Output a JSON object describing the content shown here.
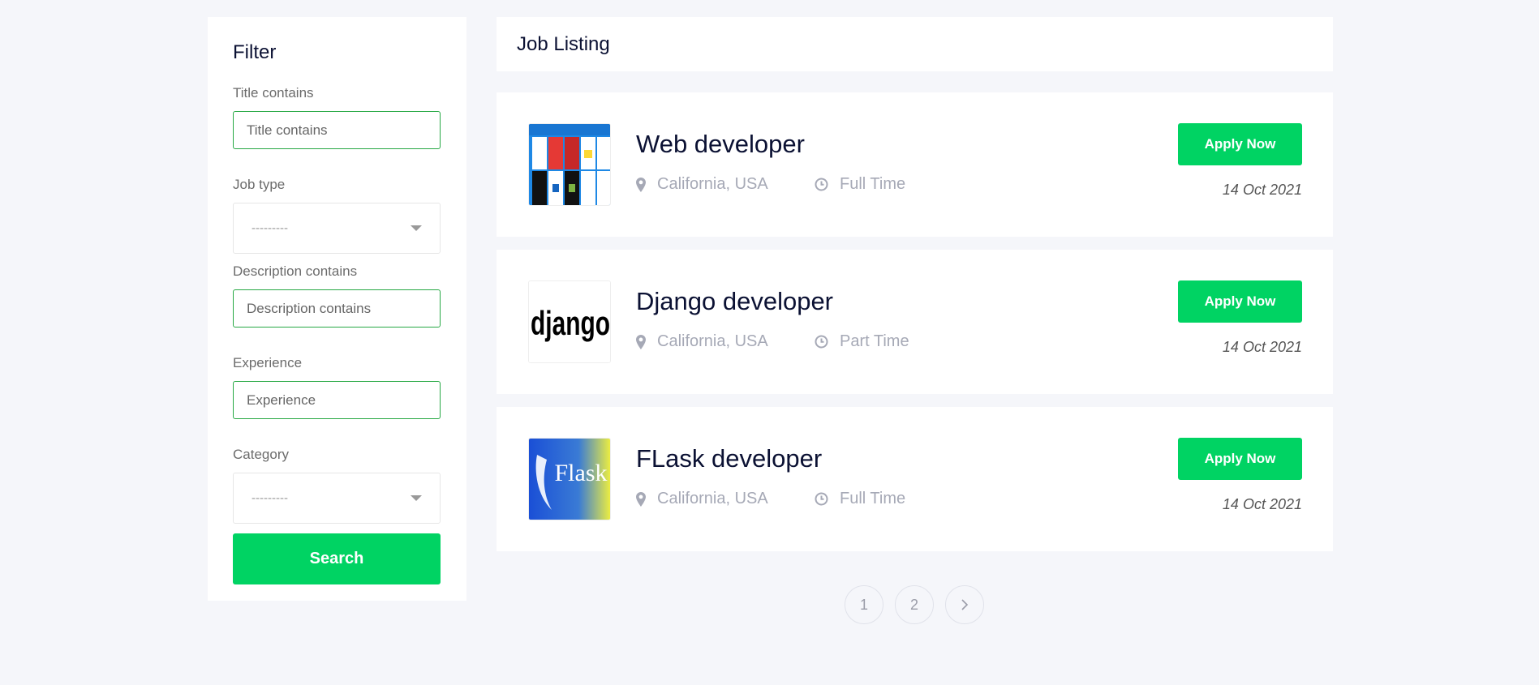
{
  "filter": {
    "heading": "Filter",
    "title_label": "Title contains",
    "title_placeholder": "Title contains",
    "job_type_label": "Job type",
    "job_type_value": "---------",
    "description_label": "Description contains",
    "description_placeholder": "Description contains",
    "experience_label": "Experience",
    "experience_placeholder": "Experience",
    "category_label": "Category",
    "category_value": "---------",
    "search_label": "Search"
  },
  "header": {
    "title": "Job Listing"
  },
  "jobs": [
    {
      "title": "Web developer",
      "location": "California, USA",
      "type": "Full Time",
      "apply_label": "Apply Now",
      "date": "14 Oct 2021",
      "logo": "frameworks-logo"
    },
    {
      "title": "Django developer",
      "location": "California, USA",
      "type": "Part Time",
      "apply_label": "Apply Now",
      "date": "14 Oct 2021",
      "logo": "django-logo",
      "logo_text": "django"
    },
    {
      "title": "FLask developer",
      "location": "California, USA",
      "type": "Full Time",
      "apply_label": "Apply Now",
      "date": "14 Oct 2021",
      "logo": "flask-logo",
      "logo_text": "Flask"
    }
  ],
  "pagination": {
    "pages": [
      "1",
      "2"
    ],
    "next_icon": "chevron-right-icon"
  },
  "colors": {
    "accent": "#00d363",
    "input_border": "#27a844",
    "background": "#f5f6fa",
    "text_dark": "#0b1133",
    "meta": "#a6a9b6"
  }
}
